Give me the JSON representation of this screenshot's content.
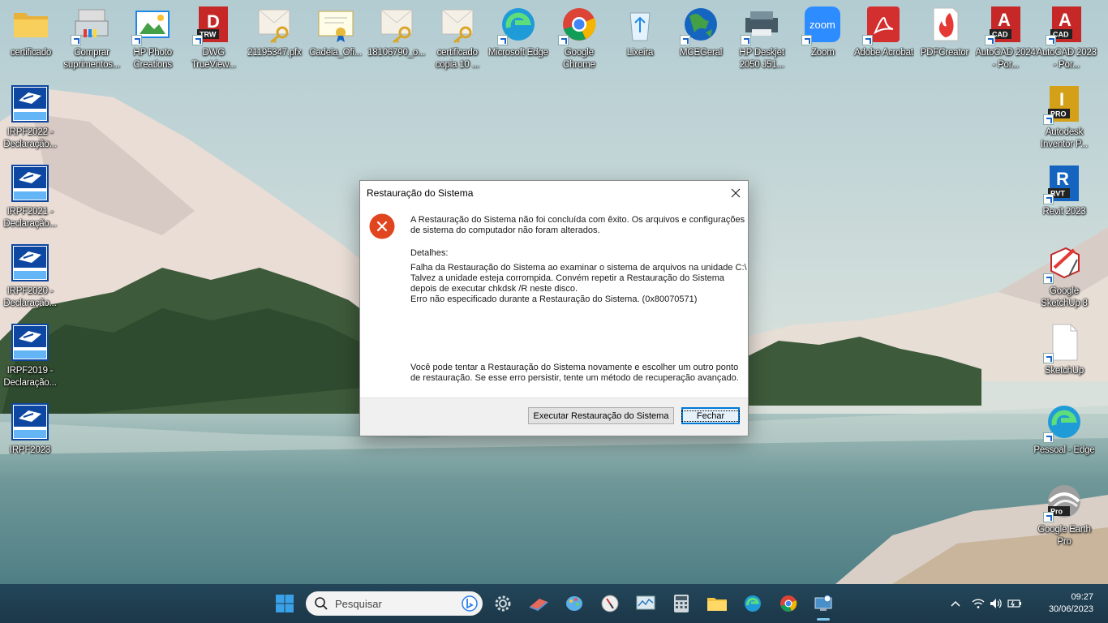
{
  "desktop": {
    "top_icons": [
      {
        "label": "certificado",
        "icon": "folder-icon"
      },
      {
        "label": "Comprar suprimentos...",
        "icon": "printer-supplies-icon"
      },
      {
        "label": "HP Photo Creations",
        "icon": "photo-creations-icon"
      },
      {
        "label": "DWG TrueView...",
        "icon": "dwg-trueview-icon",
        "badge": "TRW"
      },
      {
        "label": "21195347.pfx",
        "icon": "certificate-key-icon"
      },
      {
        "label": "Cadeia_Ofi...",
        "icon": "certificate-chain-icon"
      },
      {
        "label": "18106790_o...",
        "icon": "certificate-key-icon"
      },
      {
        "label": "certificado copia 10 ...",
        "icon": "certificate-key-icon"
      },
      {
        "label": "Microsoft Edge",
        "icon": "edge-icon"
      },
      {
        "label": "Google Chrome",
        "icon": "chrome-icon"
      },
      {
        "label": "Lixeira",
        "icon": "recycle-bin-icon"
      },
      {
        "label": "MCEGeral",
        "icon": "globe-icon"
      },
      {
        "label": "HP Deskjet 2050 J51...",
        "icon": "hp-printer-icon"
      },
      {
        "label": "Zoom",
        "icon": "zoom-icon"
      },
      {
        "label": "Adobe Acrobat",
        "icon": "acrobat-icon"
      },
      {
        "label": "PDFCreator",
        "icon": "pdfcreator-icon"
      },
      {
        "label": "AutoCAD 2024 - Por...",
        "icon": "autocad-icon",
        "badge": "CAD"
      },
      {
        "label": "AutoCAD 2023 - Por...",
        "icon": "autocad-icon",
        "badge": "CAD"
      }
    ],
    "left_icons": [
      {
        "label": "IRPF2022 - Declaração...",
        "icon": "irpf-icon"
      },
      {
        "label": "IRPF2021 - Declaração...",
        "icon": "irpf-icon"
      },
      {
        "label": "IRPF2020 - Declaração...",
        "icon": "irpf-icon"
      },
      {
        "label": "IRPF2019 - Declaração...",
        "icon": "irpf-icon"
      },
      {
        "label": "IRPF2023",
        "icon": "irpf-icon"
      }
    ],
    "right_icons": [
      {
        "label": "Autodesk Inventor P...",
        "icon": "inventor-icon",
        "badge": "PRO"
      },
      {
        "label": "Revit 2023",
        "icon": "revit-icon",
        "badge": "RVT"
      },
      {
        "label": "Google SketchUp 8",
        "icon": "sketchup-icon"
      },
      {
        "label": "SketchUp",
        "icon": "blank-file-icon"
      },
      {
        "label": "Pessoal - Edge",
        "icon": "edge-profile-icon"
      },
      {
        "label": "Google Earth Pro",
        "icon": "google-earth-icon",
        "badge": "Pro"
      }
    ]
  },
  "dialog": {
    "title": "Restauração do Sistema",
    "message_line1": "A Restauração do Sistema não foi concluída com êxito. Os arquivos e configurações",
    "message_line2": "de sistema do computador não foram alterados.",
    "details_label": "Detalhes:",
    "details_line1": "Falha da Restauração do Sistema ao examinar o sistema de arquivos na unidade C:\\",
    "details_line2": "Talvez a unidade esteja corrompida. Convém repetir a Restauração do Sistema",
    "details_line3": "depois de executar chkdsk /R neste disco.",
    "details_line4": "Erro não especificado durante a Restauração do Sistema. (0x80070571)",
    "advice_line1": "Você pode tentar a Restauração do Sistema novamente e escolher um outro ponto",
    "advice_line2": "de restauração. Se esse erro persistir, tente um método de recuperação avançado.",
    "run_button": "Executar Restauração do Sistema",
    "close_button": "Fechar"
  },
  "taskbar": {
    "search_placeholder": "Pesquisar",
    "time": "09:27",
    "date": "30/06/2023"
  },
  "colors": {
    "taskbar": "#1b3748",
    "error_red": "#e0451f",
    "accent": "#0078d7"
  }
}
